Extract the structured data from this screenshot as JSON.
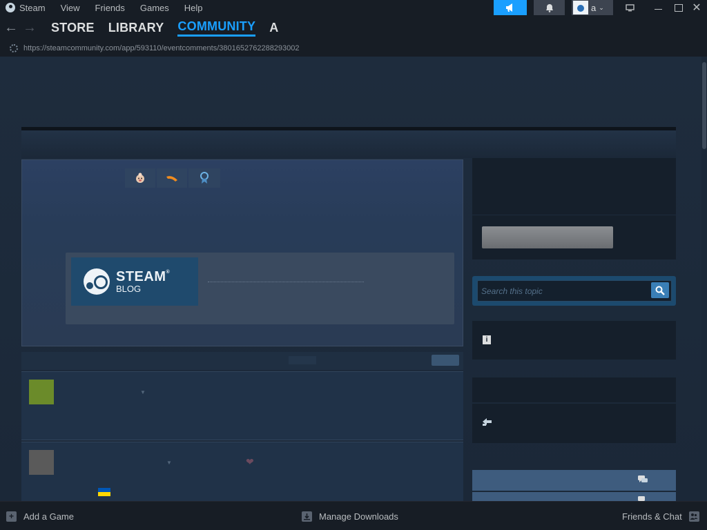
{
  "menu": {
    "steam": "Steam",
    "view": "View",
    "friends": "Friends",
    "games": "Games",
    "help": "Help"
  },
  "account": {
    "name": "a"
  },
  "nav": {
    "store": "STORE",
    "library": "LIBRARY",
    "community": "COMMUNITY",
    "user": "A"
  },
  "url": "https://steamcommunity.com/app/593110/eventcomments/3801652762288293002",
  "blog_logo": {
    "word1": "STEAM",
    "trademark": "®",
    "word2": "BLOG"
  },
  "search": {
    "placeholder": "Search this topic"
  },
  "bottom": {
    "add_game": "Add a Game",
    "manage_downloads": "Manage Downloads",
    "friends_chat": "Friends & Chat"
  },
  "colors": {
    "accent": "#1a9fff",
    "background": "#1b2838",
    "titlebar": "#171d25"
  },
  "icons": {
    "award_1": "face-award-icon",
    "award_2": "boomerang-award-icon",
    "award_3": "ribbon-award-icon",
    "info": "info-icon",
    "share": "share-icon",
    "chat": "chat-bubbles-icon"
  }
}
